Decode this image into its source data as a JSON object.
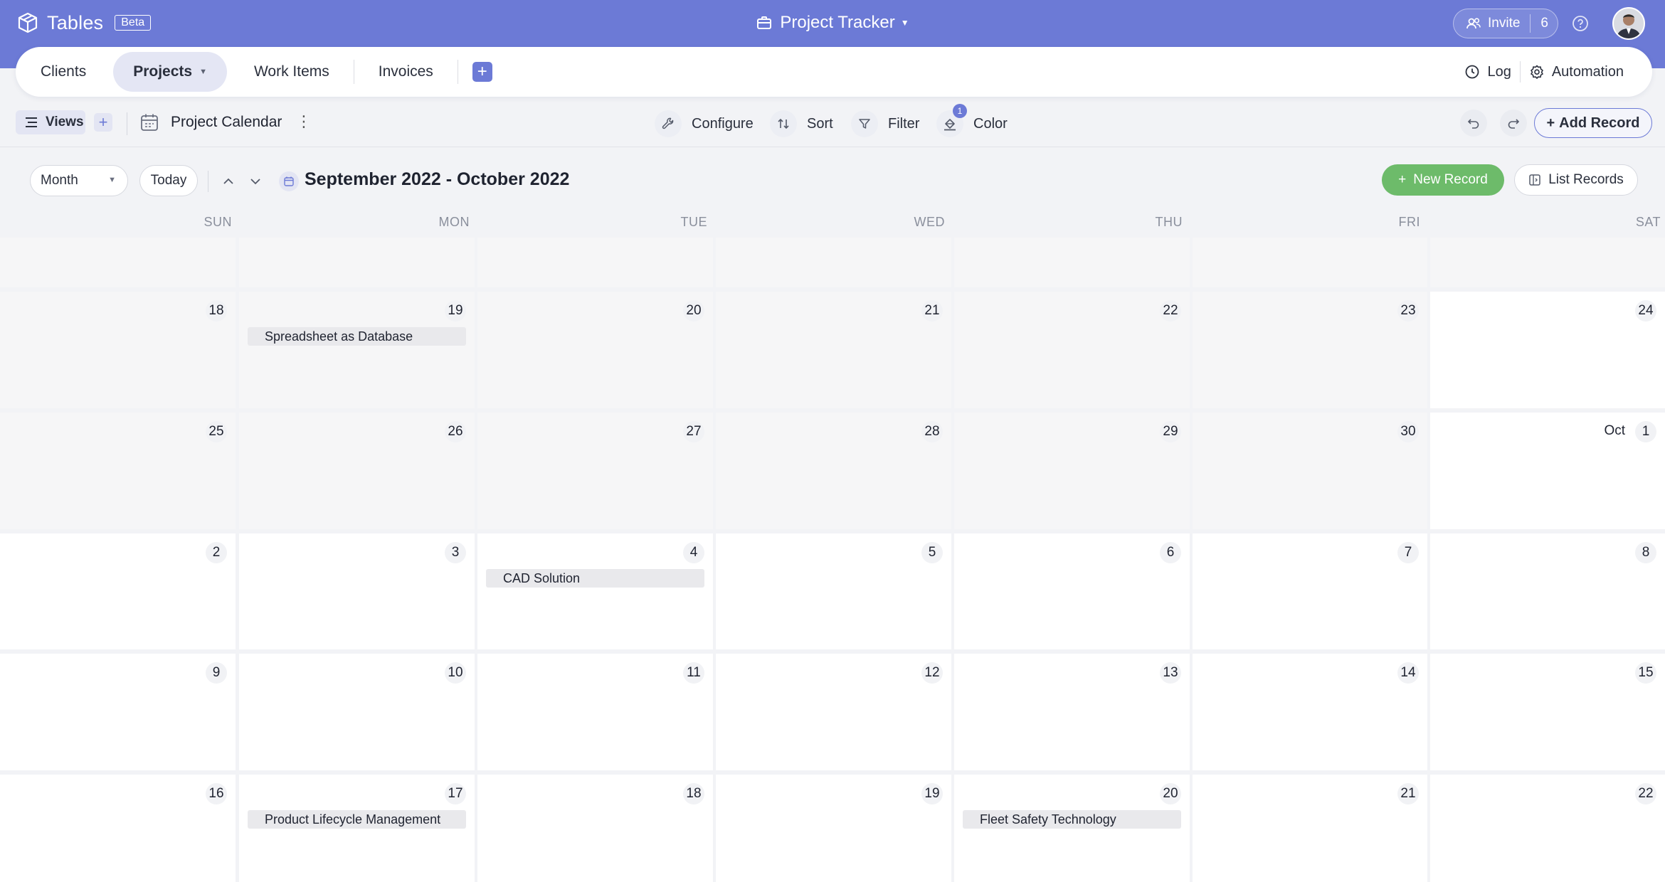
{
  "app": {
    "name": "Tables",
    "beta_label": "Beta",
    "project_title": "Project Tracker",
    "invite_label": "Invite",
    "invite_count": "6"
  },
  "tabs": [
    {
      "label": "Clients"
    },
    {
      "label": "Projects"
    },
    {
      "label": "Work Items"
    },
    {
      "label": "Invoices"
    }
  ],
  "tabbar_right": {
    "log_label": "Log",
    "automation_label": "Automation"
  },
  "toolbar": {
    "views_label": "Views",
    "view_name": "Project Calendar",
    "configure_label": "Configure",
    "sort_label": "Sort",
    "filter_label": "Filter",
    "color_label": "Color",
    "color_badge": "1",
    "add_record_label": "Add Record"
  },
  "calendar": {
    "mode": "Month",
    "today_label": "Today",
    "range_title": "September 2022 - October 2022",
    "new_record_label": "New Record",
    "list_records_label": "List Records",
    "weekdays": [
      "SUN",
      "MON",
      "TUE",
      "WED",
      "THU",
      "FRI",
      "SAT"
    ],
    "weeks": [
      {
        "days": [
          "",
          "",
          "",
          "",
          "",
          "",
          ""
        ]
      },
      {
        "days": [
          "18",
          "19",
          "20",
          "21",
          "22",
          "23",
          "24"
        ]
      },
      {
        "days": [
          "25",
          "26",
          "27",
          "28",
          "29",
          "30",
          "1"
        ]
      },
      {
        "days": [
          "2",
          "3",
          "4",
          "5",
          "6",
          "7",
          "8"
        ]
      },
      {
        "days": [
          "9",
          "10",
          "11",
          "12",
          "13",
          "14",
          "15"
        ]
      },
      {
        "days": [
          "16",
          "17",
          "18",
          "19",
          "20",
          "21",
          "22"
        ]
      }
    ],
    "month_marker": "Oct",
    "events": [
      {
        "title": "Spreadsheet as Database",
        "week": 1,
        "day": 1
      },
      {
        "title": "CAD Solution",
        "week": 3,
        "day": 2
      },
      {
        "title": "Product Lifecycle Management",
        "week": 5,
        "day": 1
      },
      {
        "title": "Fleet Safety Technology",
        "week": 5,
        "day": 4
      }
    ]
  },
  "colors": {
    "accent": "#6c7ad6",
    "new_record_green": "#6dbb6a"
  }
}
